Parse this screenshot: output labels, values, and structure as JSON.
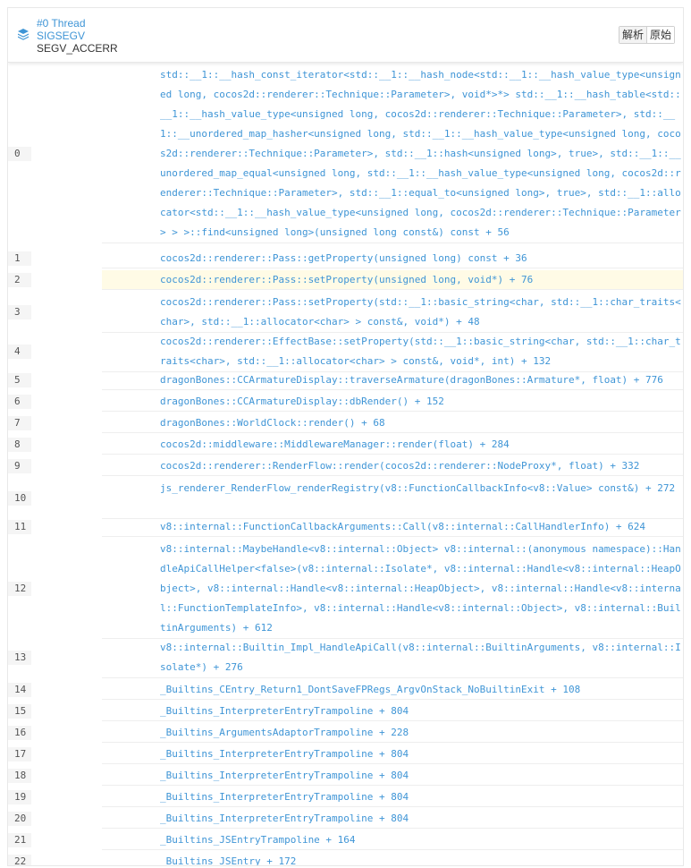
{
  "header": {
    "thread_title": "#0 Thread",
    "signal": "SIGSEGV",
    "code": "SEGV_ACCERR",
    "btn_parsed": "解析",
    "btn_raw": "原始"
  },
  "colors": {
    "link": "#3f95d6",
    "highlight": "#fffbe6",
    "border": "#e8e8e8"
  },
  "highlighted_frame": "2",
  "frames": [
    {
      "num": "0",
      "sym": "std::__1::__hash_const_iterator<std::__1::__hash_node<std::__1::__hash_value_type<unsigned long, cocos2d::renderer::Technique::Parameter>, void*>*> std::__1::__hash_table<std::__1::__hash_value_type<unsigned long, cocos2d::renderer::Technique::Parameter>, std::__1::__unordered_map_hasher<unsigned long, std::__1::__hash_value_type<unsigned long, cocos2d::renderer::Technique::Parameter>, std::__1::hash<unsigned long>, true>, std::__1::__unordered_map_equal<unsigned long, std::__1::__hash_value_type<unsigned long, cocos2d::renderer::Technique::Parameter>, std::__1::equal_to<unsigned long>, true>, std::__1::allocator<std::__1::__hash_value_type<unsigned long, cocos2d::renderer::Technique::Parameter> > >::find<unsigned long>(unsigned long const&) const + 56"
    },
    {
      "num": "1",
      "sym": "cocos2d::renderer::Pass::getProperty(unsigned long) const + 36"
    },
    {
      "num": "2",
      "sym": "cocos2d::renderer::Pass::setProperty(unsigned long, void*) + 76"
    },
    {
      "num": "3",
      "sym": "cocos2d::renderer::Pass::setProperty(std::__1::basic_string<char, std::__1::char_traits<char>, std::__1::allocator<char> > const&, void*) + 48"
    },
    {
      "num": "4",
      "sym": "cocos2d::renderer::EffectBase::setProperty(std::__1::basic_string<char, std::__1::char_traits<char>, std::__1::allocator<char> > const&, void*, int) + 132"
    },
    {
      "num": "5",
      "sym": "dragonBones::CCArmatureDisplay::traverseArmature(dragonBones::Armature*, float) + 776"
    },
    {
      "num": "6",
      "sym": "dragonBones::CCArmatureDisplay::dbRender() + 152"
    },
    {
      "num": "7",
      "sym": "dragonBones::WorldClock::render() + 68"
    },
    {
      "num": "8",
      "sym": "cocos2d::middleware::MiddlewareManager::render(float) + 284"
    },
    {
      "num": "9",
      "sym": "cocos2d::renderer::RenderFlow::render(cocos2d::renderer::NodeProxy*, float) + 332"
    },
    {
      "num": "10",
      "sym": "js_renderer_RenderFlow_renderRegistry(v8::FunctionCallbackInfo<v8::Value> const&) + 272"
    },
    {
      "num": "11",
      "sym": "v8::internal::FunctionCallbackArguments::Call(v8::internal::CallHandlerInfo) + 624"
    },
    {
      "num": "12",
      "sym": "v8::internal::MaybeHandle<v8::internal::Object> v8::internal::(anonymous namespace)::HandleApiCallHelper<false>(v8::internal::Isolate*, v8::internal::Handle<v8::internal::HeapObject>, v8::internal::Handle<v8::internal::HeapObject>, v8::internal::Handle<v8::internal::FunctionTemplateInfo>, v8::internal::Handle<v8::internal::Object>, v8::internal::BuiltinArguments) + 612"
    },
    {
      "num": "13",
      "sym": "v8::internal::Builtin_Impl_HandleApiCall(v8::internal::BuiltinArguments, v8::internal::Isolate*) + 276"
    },
    {
      "num": "14",
      "sym": "_Builtins_CEntry_Return1_DontSaveFPRegs_ArgvOnStack_NoBuiltinExit + 108"
    },
    {
      "num": "15",
      "sym": "_Builtins_InterpreterEntryTrampoline + 804"
    },
    {
      "num": "16",
      "sym": "_Builtins_ArgumentsAdaptorTrampoline + 228"
    },
    {
      "num": "17",
      "sym": "_Builtins_InterpreterEntryTrampoline + 804"
    },
    {
      "num": "18",
      "sym": "_Builtins_InterpreterEntryTrampoline + 804"
    },
    {
      "num": "19",
      "sym": "_Builtins_InterpreterEntryTrampoline + 804"
    },
    {
      "num": "20",
      "sym": "_Builtins_InterpreterEntryTrampoline + 804"
    },
    {
      "num": "21",
      "sym": "_Builtins_JSEntryTrampoline + 164"
    },
    {
      "num": "22",
      "sym": "_Builtins_JSEntry + 172"
    }
  ]
}
